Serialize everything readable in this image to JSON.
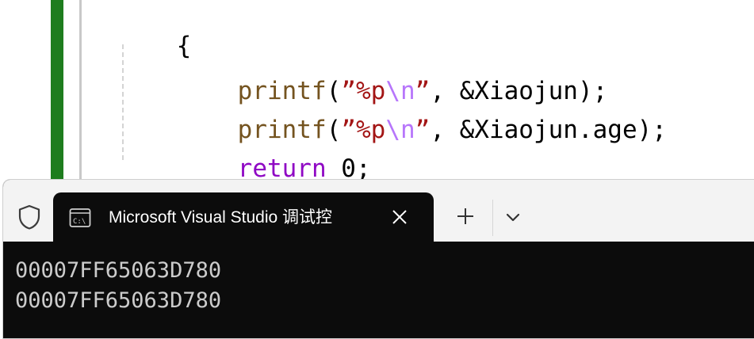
{
  "colors": {
    "keyword": "#8f08c4",
    "function": "#74531f",
    "string": "#a31515",
    "escape": "#b776fb",
    "text": "#000000",
    "change_bar": "#1e7d1e",
    "terminal_bg": "#0c0c0c",
    "terminal_text": "#cccccc"
  },
  "editor": {
    "lines": [
      {
        "open_brace": "{"
      },
      {
        "func": "printf",
        "p1": "(",
        "q1": "”",
        "fmt": "%p",
        "esc": "\\n",
        "q2": "”",
        "rest": ", &Xiaojun);"
      },
      {
        "func": "printf",
        "p1": "(",
        "q1": "”",
        "fmt": "%p",
        "esc": "\\n",
        "q2": "”",
        "rest": ", &Xiaojun.age);"
      },
      {
        "kw": "return",
        "rest": " 0;"
      },
      {
        "close_brace": "}"
      }
    ]
  },
  "terminal": {
    "tab_icon": "console-icon",
    "tab_title": "Microsoft Visual Studio 调试控",
    "output_lines": [
      "00007FF65063D780",
      "00007FF65063D780"
    ]
  }
}
